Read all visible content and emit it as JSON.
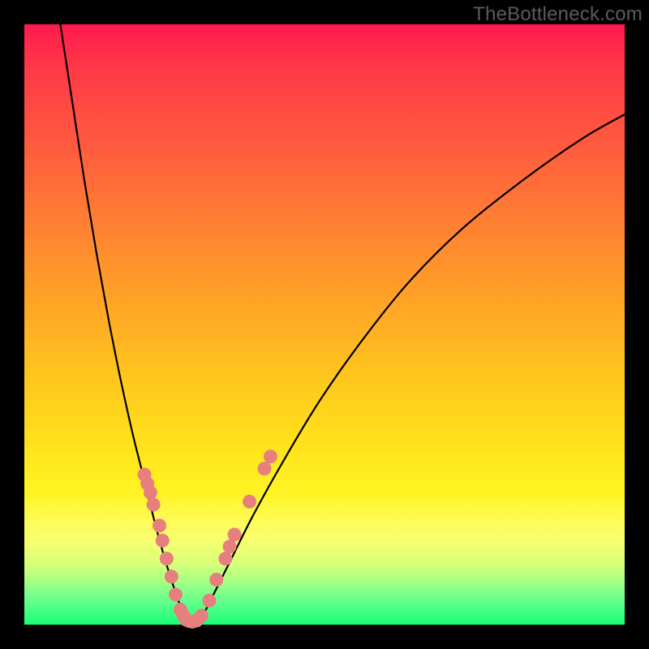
{
  "watermark": "TheBottleneck.com",
  "colors": {
    "curve": "#000000",
    "dots": "#e77f7f",
    "dots_stroke": "#d96a6a"
  },
  "chart_data": {
    "type": "line",
    "title": "",
    "xlabel": "",
    "ylabel": "",
    "xlim": [
      0,
      100
    ],
    "ylim": [
      0,
      100
    ],
    "grid": false,
    "left_curve": {
      "x": [
        6,
        8,
        10,
        12,
        14,
        16,
        18,
        20,
        22,
        24,
        26,
        27
      ],
      "y": [
        100,
        87,
        74,
        62,
        51,
        41,
        32,
        24,
        16,
        9,
        3,
        0
      ]
    },
    "right_curve": {
      "x": [
        29,
        31,
        34,
        38,
        43,
        49,
        56,
        64,
        73,
        83,
        93,
        100
      ],
      "y": [
        0,
        4,
        10,
        18,
        27,
        37,
        47,
        57,
        66,
        74,
        81,
        85
      ]
    },
    "series": [
      {
        "name": "highlighted-points",
        "points": [
          {
            "x": 20.0,
            "y": 25.0
          },
          {
            "x": 20.5,
            "y": 23.5
          },
          {
            "x": 21.0,
            "y": 22.0
          },
          {
            "x": 21.5,
            "y": 20.0
          },
          {
            "x": 22.5,
            "y": 16.5
          },
          {
            "x": 23.0,
            "y": 14.0
          },
          {
            "x": 23.7,
            "y": 11.0
          },
          {
            "x": 24.5,
            "y": 8.0
          },
          {
            "x": 25.2,
            "y": 5.0
          },
          {
            "x": 26.0,
            "y": 2.5
          },
          {
            "x": 26.5,
            "y": 1.5
          },
          {
            "x": 27.0,
            "y": 0.8
          },
          {
            "x": 27.5,
            "y": 0.6
          },
          {
            "x": 28.0,
            "y": 0.5
          },
          {
            "x": 28.7,
            "y": 0.7
          },
          {
            "x": 29.5,
            "y": 1.5
          },
          {
            "x": 30.8,
            "y": 4.0
          },
          {
            "x": 32.0,
            "y": 7.5
          },
          {
            "x": 33.5,
            "y": 11.0
          },
          {
            "x": 34.2,
            "y": 13.0
          },
          {
            "x": 35.0,
            "y": 15.0
          },
          {
            "x": 37.5,
            "y": 20.5
          },
          {
            "x": 40.0,
            "y": 26.0
          },
          {
            "x": 41.0,
            "y": 28.0
          }
        ]
      }
    ]
  }
}
